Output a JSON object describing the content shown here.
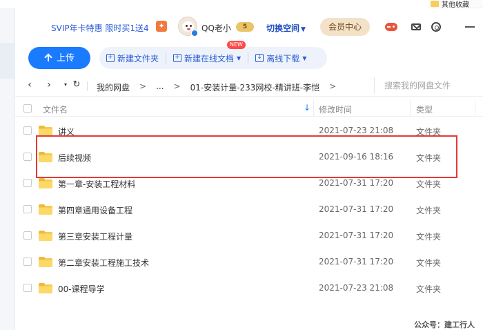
{
  "top_bookmark": {
    "label": "其他收藏"
  },
  "header": {
    "svip_promo": "SVIP年卡特惠 限时买1送4",
    "username": "QQ老小",
    "vip_level": "5",
    "switch_space": "切换空间",
    "member_center": "会员中心",
    "icons": [
      "gift-icon",
      "avatar",
      "gamepad-icon",
      "mail-icon",
      "settings-icon",
      "minimize-icon"
    ]
  },
  "toolbar": {
    "upload": "上传",
    "new_folder": "新建文件夹",
    "new_online_doc": "新建在线文档",
    "new_badge": "NEW",
    "offline_download": "离线下载"
  },
  "nav": {
    "history_caret": "▾",
    "breadcrumbs": [
      "我的网盘",
      ">",
      "...",
      ">",
      "01-安装计量-233网校-精讲班-李恺",
      ">"
    ],
    "search_placeholder": "搜索我的网盘文件"
  },
  "table": {
    "columns": {
      "name": "文件名",
      "mtime": "修改时间",
      "type": "类型"
    },
    "rows": [
      {
        "name": "讲义",
        "mtime": "2021-07-23 21:08",
        "type": "文件夹"
      },
      {
        "name": "后续视频",
        "mtime": "2021-09-16 18:16",
        "type": "文件夹"
      },
      {
        "name": "第一章-安装工程材料",
        "mtime": "2021-07-31 17:20",
        "type": "文件夹"
      },
      {
        "name": "第四章通用设备工程",
        "mtime": "2021-07-31 17:20",
        "type": "文件夹"
      },
      {
        "name": "第三章安装工程计量",
        "mtime": "2021-07-31 17:20",
        "type": "文件夹"
      },
      {
        "name": "第二章安装工程施工技术",
        "mtime": "2021-07-31 17:20",
        "type": "文件夹"
      },
      {
        "name": "00-课程导学",
        "mtime": "2021-07-23 21:08",
        "type": "文件夹"
      }
    ]
  },
  "watermark": "公众号：建工行人",
  "colors": {
    "accent": "#1a7bff",
    "highlight": "#e53935",
    "folder": "#f6cc4e",
    "link": "#2a5bd7"
  }
}
